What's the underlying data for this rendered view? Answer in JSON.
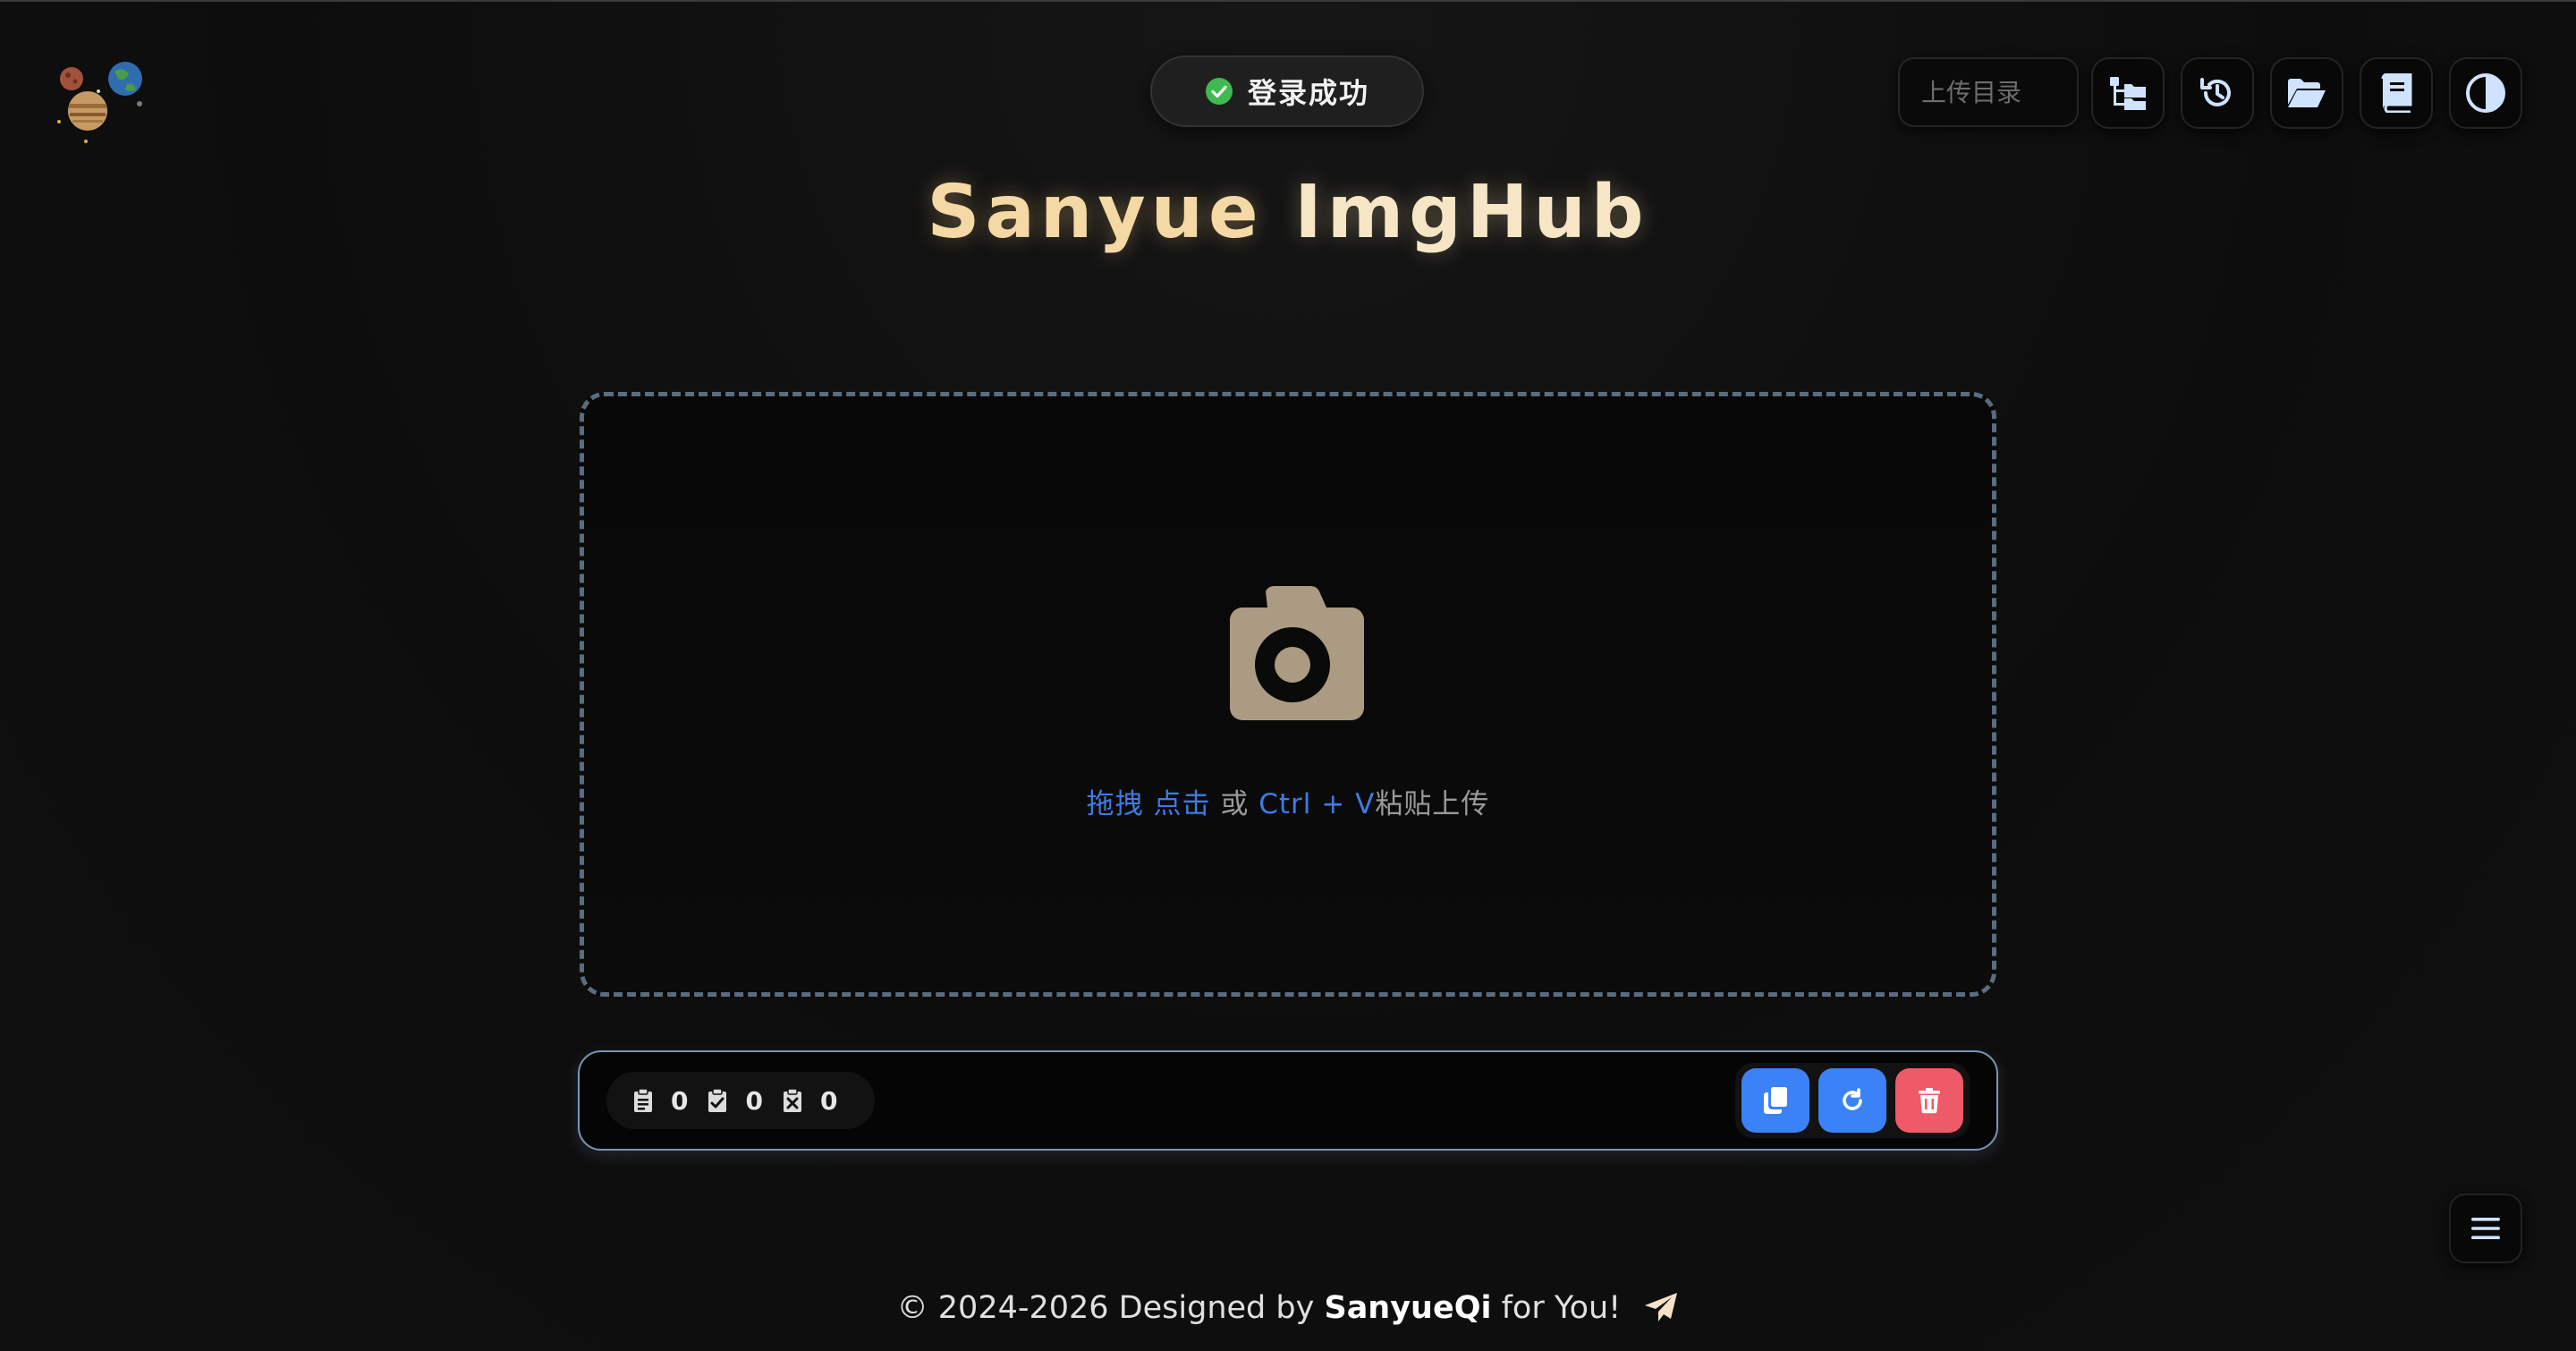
{
  "toast": {
    "message": "登录成功",
    "icon": "check-circle-icon",
    "icon_color": "#3fb950"
  },
  "header": {
    "title_part1": "Sanyue",
    "title_part2": "ImgHub",
    "upload_dir_placeholder": "上传目录",
    "tools": [
      {
        "name": "directory-tree-icon"
      },
      {
        "name": "history-icon"
      },
      {
        "name": "folder-open-icon"
      },
      {
        "name": "book-icon"
      },
      {
        "name": "theme-toggle-icon"
      }
    ],
    "accent_color": "#cfe3ff"
  },
  "dropzone": {
    "icon": "camera-icon",
    "icon_color": "#ab9b82",
    "hint_drag": "拖拽",
    "hint_click": "点击",
    "hint_or": "或",
    "hint_shortcut": "Ctrl + V",
    "hint_paste": "粘贴上传",
    "border_color": "#5b6c7f"
  },
  "stats": {
    "total": "0",
    "success": "0",
    "failed": "0"
  },
  "actions": {
    "copy_icon": "copy-icon",
    "retry_icon": "refresh-icon",
    "clear_icon": "trash-icon",
    "primary_color": "#3b82f6",
    "danger_color": "#ee5a67"
  },
  "footer": {
    "prefix": "© 2024-2026 Designed by",
    "author": "SanyueQi",
    "suffix": "for You!",
    "icon": "paper-plane-icon"
  }
}
